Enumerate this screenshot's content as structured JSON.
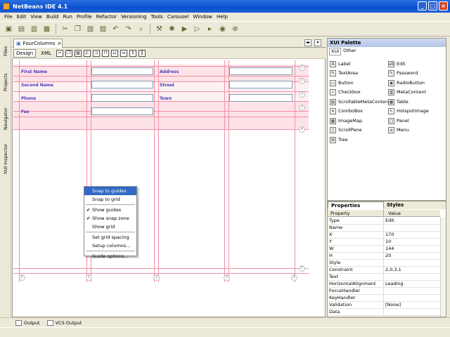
{
  "window": {
    "title": "NetBeans IDE 4.1",
    "minimize": "_",
    "maximize": "□",
    "close": "×"
  },
  "menu": [
    "File",
    "Edit",
    "View",
    "Build",
    "Run",
    "Profile",
    "Refactor",
    "Versioning",
    "Tools",
    "Carousel",
    "Window",
    "Help"
  ],
  "side_tabs": [
    "Files",
    "Projects",
    "Navigator",
    "XUI Inspector"
  ],
  "doc_tab": {
    "label": "FourColumns",
    "close": "×"
  },
  "editor_tabs": {
    "design": "Design",
    "xml": "XML"
  },
  "form": {
    "first_name": "First Name",
    "second_name": "Second Name",
    "phone": "Phone",
    "fax": "Fax",
    "address": "Address",
    "street": "Street",
    "town": "Town"
  },
  "context_menu": [
    {
      "label": "Snap to guides",
      "checked": false,
      "selected": true
    },
    {
      "label": "Snap to grid",
      "checked": false,
      "selected": false
    },
    {
      "label": "Show guides",
      "checked": true,
      "selected": false
    },
    {
      "label": "Show snap zone",
      "checked": true,
      "selected": false
    },
    {
      "label": "Show grid",
      "checked": false,
      "selected": false
    },
    {
      "label": "Set grid spacing",
      "checked": false,
      "selected": false
    },
    {
      "label": "Setup columns...",
      "checked": false,
      "selected": false
    },
    {
      "label": "Guide options...",
      "checked": false,
      "selected": false
    }
  ],
  "palette": {
    "title": "XUI Palette",
    "tabs": [
      "XUI",
      "Other"
    ],
    "items_left": [
      "Label",
      "TextArea",
      "Button",
      "Checkbox",
      "ScrollableMetaContent",
      "ComboBox",
      "ImageMap",
      "ScrollPane",
      "Tree"
    ],
    "items_right": [
      "Edit",
      "Password",
      "RadioButton",
      "MetaContent",
      "Table",
      "HotspotImage",
      "Panel",
      "Menu"
    ]
  },
  "properties": {
    "tab_properties": "Properties",
    "tab_styles": "Styles",
    "col_property": "Property",
    "col_value": "Value",
    "rows": [
      {
        "k": "Type",
        "v": "Edit"
      },
      {
        "k": "Name",
        "v": ""
      },
      {
        "k": "X",
        "v": "170"
      },
      {
        "k": "Y",
        "v": "10"
      },
      {
        "k": "W",
        "v": "144"
      },
      {
        "k": "H",
        "v": "20"
      },
      {
        "k": "Style",
        "v": ""
      },
      {
        "k": "Constraint",
        "v": "2,0,3,1"
      },
      {
        "k": "Text",
        "v": ""
      },
      {
        "k": "HorizontalAlignment",
        "v": "Leading"
      },
      {
        "k": "FocusHandler",
        "v": ""
      },
      {
        "k": "KeyHandler",
        "v": ""
      },
      {
        "k": "Validation",
        "v": "[None]"
      },
      {
        "k": "Data",
        "v": ""
      }
    ]
  },
  "status": {
    "output": "Output",
    "vcs_output": "VCS Output"
  }
}
